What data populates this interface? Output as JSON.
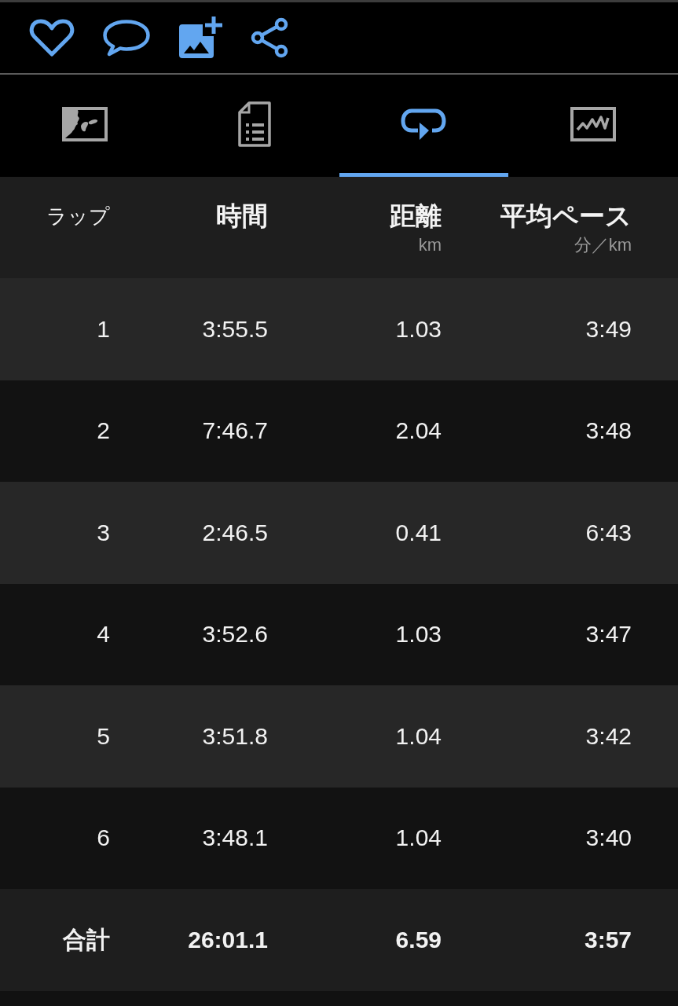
{
  "actions": [
    {
      "kind": "like"
    },
    {
      "kind": "comment"
    },
    {
      "kind": "add-photo"
    },
    {
      "kind": "share"
    }
  ],
  "tabs": [
    {
      "kind": "map",
      "selected": false
    },
    {
      "kind": "details",
      "selected": false
    },
    {
      "kind": "laps",
      "selected": true
    },
    {
      "kind": "charts",
      "selected": false
    }
  ],
  "table": {
    "columns": [
      {
        "label": "ラップ"
      },
      {
        "label": "時間"
      },
      {
        "label": "距離",
        "unit": "km"
      },
      {
        "label": "平均ペース",
        "unit": "分／km"
      }
    ],
    "rows": [
      {
        "cells": [
          "1",
          "3:55.5",
          "1.03",
          "3:49"
        ]
      },
      {
        "cells": [
          "2",
          "7:46.7",
          "2.04",
          "3:48"
        ]
      },
      {
        "cells": [
          "3",
          "2:46.5",
          "0.41",
          "6:43"
        ]
      },
      {
        "cells": [
          "4",
          "3:52.6",
          "1.03",
          "3:47"
        ]
      },
      {
        "cells": [
          "5",
          "3:51.8",
          "1.04",
          "3:42"
        ]
      },
      {
        "cells": [
          "6",
          "3:48.1",
          "1.04",
          "3:40"
        ]
      }
    ],
    "total": {
      "cells": [
        "合計",
        "26:01.1",
        "6.59",
        "3:57"
      ]
    }
  }
}
